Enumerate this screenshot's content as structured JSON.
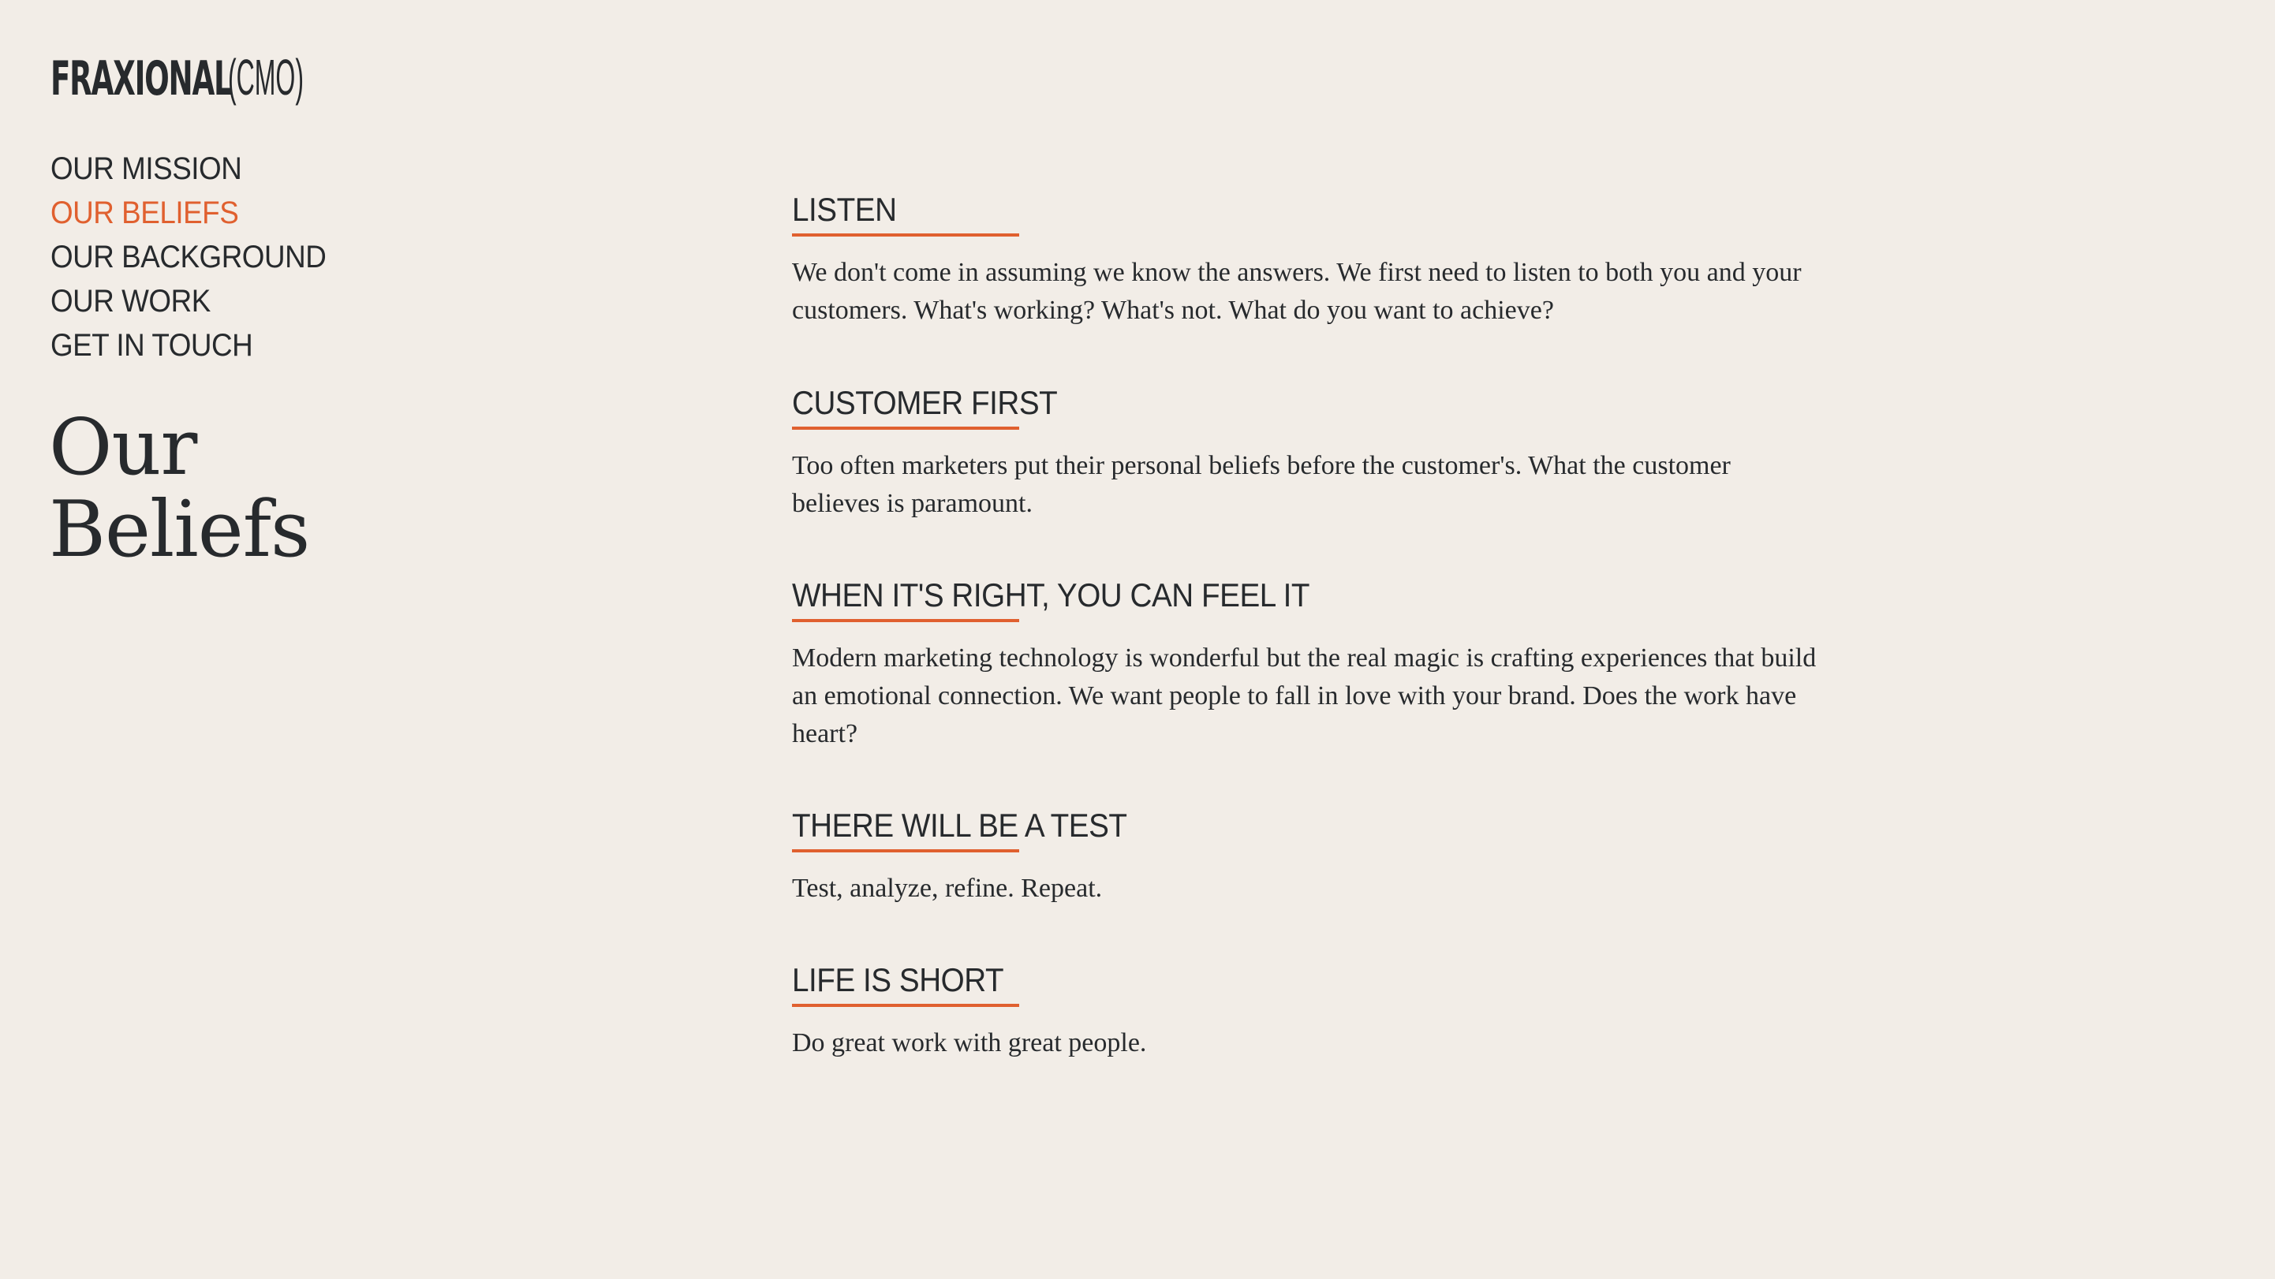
{
  "brand": {
    "logo_main": "FRAXIONAL",
    "logo_suffix": "(CMO)"
  },
  "nav": {
    "items": [
      {
        "label": "OUR MISSION",
        "active": false
      },
      {
        "label": "OUR BELIEFS",
        "active": true
      },
      {
        "label": "OUR BACKGROUND",
        "active": false
      },
      {
        "label": "OUR WORK",
        "active": false
      },
      {
        "label": "GET IN TOUCH",
        "active": false
      }
    ]
  },
  "page": {
    "title_line1": "Our",
    "title_line2": "Beliefs"
  },
  "beliefs": [
    {
      "heading": "LISTEN",
      "text": "We don't come in assuming we know the answers. We first need to listen to both you and your customers. What's working? What's not. What do you want to achieve?"
    },
    {
      "heading": "CUSTOMER FIRST",
      "text": "Too often marketers put their personal beliefs before the customer's. What the customer believes is paramount."
    },
    {
      "heading": "WHEN IT'S RIGHT, YOU CAN FEEL IT",
      "text": "Modern marketing technology is wonderful but the real magic is crafting experiences that build an emotional connection. We want people to fall in love with your brand. Does the work have heart?"
    },
    {
      "heading": "THERE WILL BE A TEST",
      "text": "Test, analyze, refine. Repeat."
    },
    {
      "heading": "LIFE IS SHORT",
      "text": "Do great work with great people."
    }
  ],
  "colors": {
    "background": "#f2ede7",
    "text": "#272a2d",
    "accent": "#e0602f"
  }
}
